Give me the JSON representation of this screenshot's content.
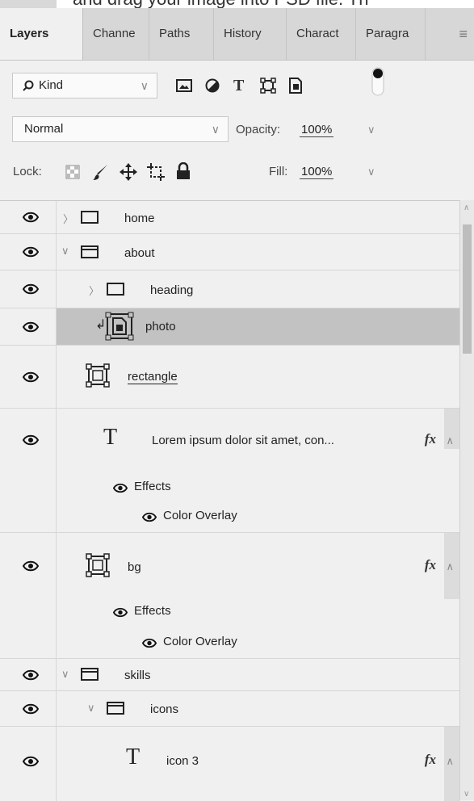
{
  "caption": {
    "text": "and drag your image into PSD file. Th"
  },
  "tabs": [
    {
      "label": "Layers",
      "active": true
    },
    {
      "label": "Channe"
    },
    {
      "label": "Paths"
    },
    {
      "label": "History"
    },
    {
      "label": "Charact"
    },
    {
      "label": "Paragra"
    }
  ],
  "filter": {
    "kind_label": "Kind"
  },
  "blend": {
    "mode": "Normal",
    "opacity_label": "Opacity:",
    "opacity_value": "100%"
  },
  "lock": {
    "label": "Lock:",
    "fill_label": "Fill:",
    "fill_value": "100%"
  },
  "layers": [
    {
      "name": "home"
    },
    {
      "name": "about"
    },
    {
      "name": "heading"
    },
    {
      "name": "photo"
    },
    {
      "name": "rectangle"
    },
    {
      "name": "Lorem ipsum dolor sit amet, con...",
      "fx": "fx",
      "effects": "Effects",
      "overlay": "Color Overlay"
    },
    {
      "name": "bg",
      "fx": "fx",
      "effects": "Effects",
      "overlay": "Color Overlay"
    },
    {
      "name": "skills"
    },
    {
      "name": "icons"
    },
    {
      "name": "icon 3",
      "fx": "fx"
    }
  ]
}
